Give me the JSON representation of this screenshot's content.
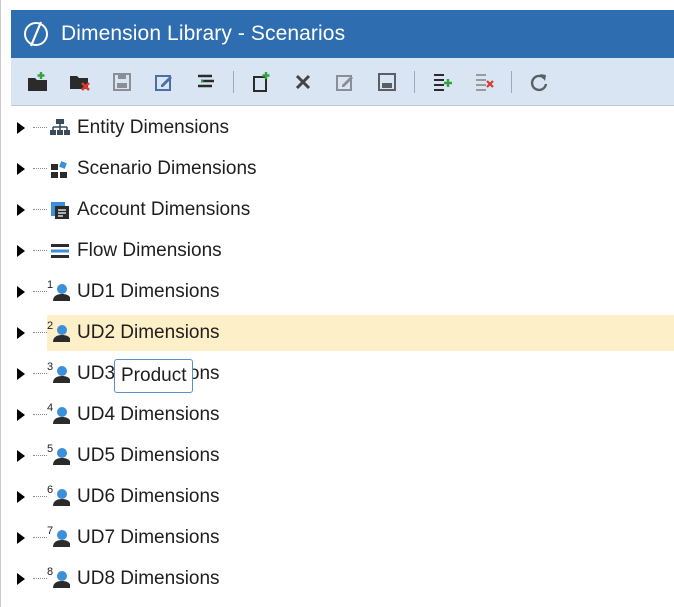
{
  "window": {
    "title": "Dimension Library - Scenarios",
    "title_bar_color": "#2e6db0",
    "toolbar_color": "#d9e5f2",
    "selected_row_color": "#fdf0c8"
  },
  "toolbar": {
    "buttons": [
      "create-group-icon",
      "delete-group-icon",
      "save-group-icon",
      "edit-group-icon",
      "collapse-tree-icon",
      "create-member-icon",
      "delete-member-icon",
      "edit-member-icon",
      "save-member-icon",
      "add-relationship-icon",
      "remove-relationship-icon",
      "refresh-icon"
    ]
  },
  "tree": {
    "items": [
      {
        "label": "Entity Dimensions",
        "icon": "entity-hierarchy-icon"
      },
      {
        "label": "Scenario Dimensions",
        "icon": "scenario-blocks-icon"
      },
      {
        "label": "Account Dimensions",
        "icon": "account-icon"
      },
      {
        "label": "Flow Dimensions",
        "icon": "flow-icon"
      },
      {
        "label": "UD1 Dimensions",
        "icon": "ud-user-icon",
        "num": "1"
      },
      {
        "label": "UD2 Dimensions",
        "icon": "ud-user-icon",
        "num": "2",
        "selected": true
      },
      {
        "label": "UD3 Dimensions",
        "icon": "ud-user-icon",
        "num": "3"
      },
      {
        "label": "UD4 Dimensions",
        "icon": "ud-user-icon",
        "num": "4"
      },
      {
        "label": "UD5 Dimensions",
        "icon": "ud-user-icon",
        "num": "5"
      },
      {
        "label": "UD6 Dimensions",
        "icon": "ud-user-icon",
        "num": "6"
      },
      {
        "label": "UD7 Dimensions",
        "icon": "ud-user-icon",
        "num": "7"
      },
      {
        "label": "UD8 Dimensions",
        "icon": "ud-user-icon",
        "num": "8"
      }
    ]
  },
  "tooltip": {
    "text": "Product"
  }
}
